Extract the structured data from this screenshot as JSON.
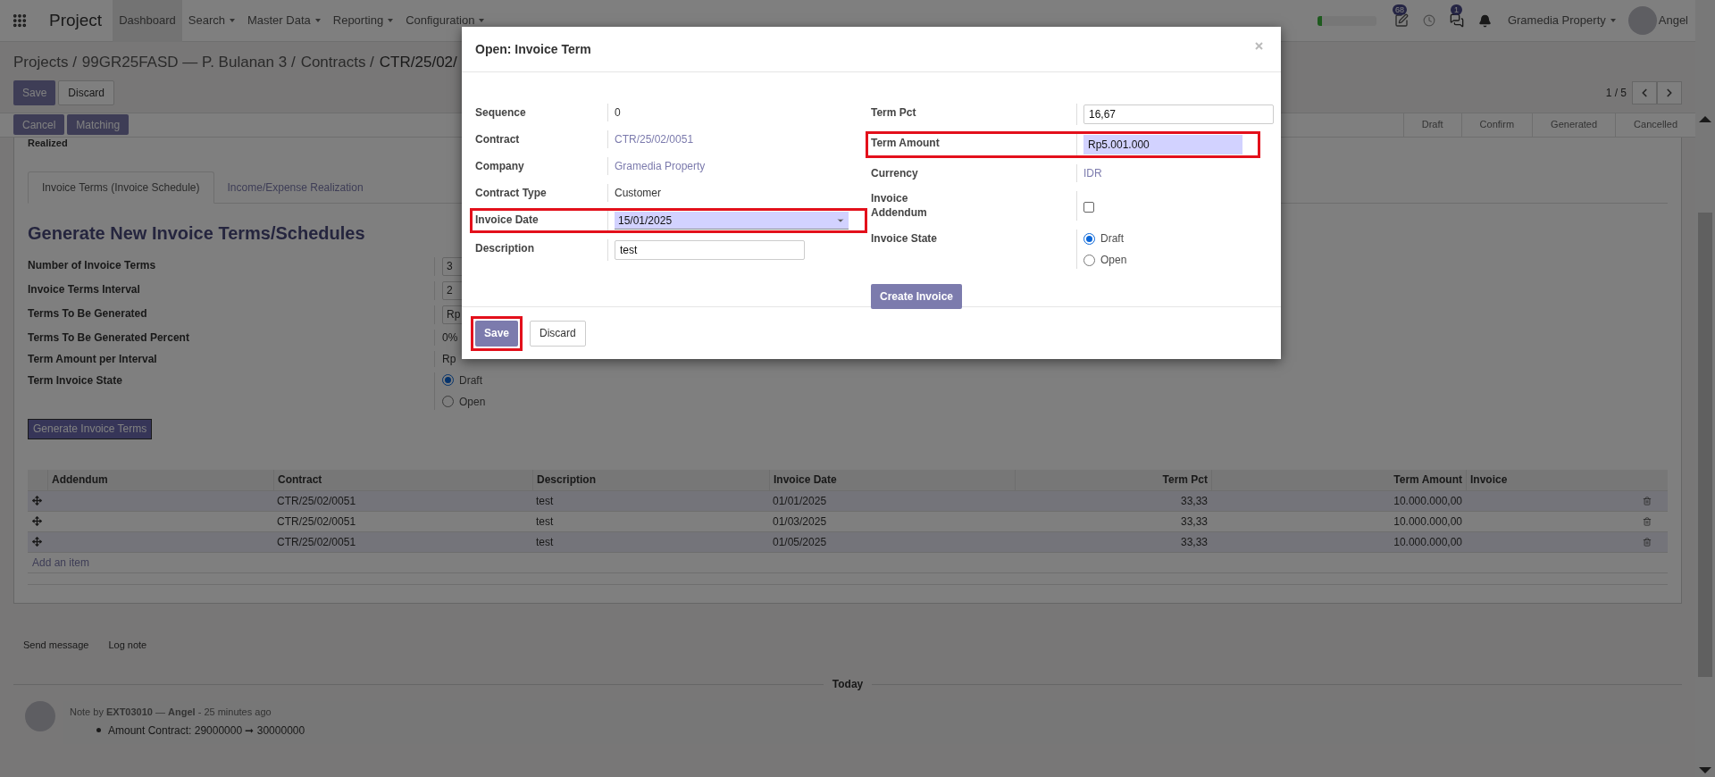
{
  "navbar": {
    "app_title": "Project",
    "menus": [
      {
        "label": "Dashboard",
        "selected": true,
        "dropdown": false
      },
      {
        "label": "Search",
        "selected": false,
        "dropdown": true
      },
      {
        "label": "Master Data",
        "selected": false,
        "dropdown": true
      },
      {
        "label": "Reporting",
        "selected": false,
        "dropdown": true
      },
      {
        "label": "Configuration",
        "selected": false,
        "dropdown": true
      }
    ],
    "activity_badge": "68",
    "message_badge": "1",
    "company": "Gramedia Property",
    "user": "Angel"
  },
  "breadcrumb": [
    "Projects /",
    "99GR25FASD — P. Bulanan 3 /",
    "Contracts /",
    "CTR/25/02/"
  ],
  "form_buttons": [
    "Save",
    "Discard"
  ],
  "pager": "1 / 5",
  "action_buttons": [
    "Cancel",
    "Matching"
  ],
  "status_steps": [
    "Draft",
    "Confirm",
    "Generated",
    "Cancelled"
  ],
  "cut_label": "Realized",
  "tabs": [
    {
      "label": "Invoice Terms (Invoice Schedule)",
      "selected": true
    },
    {
      "label": "Income/Expense Realization",
      "selected": false
    }
  ],
  "section_title": "Generate New Invoice Terms/Schedules",
  "generator_fields": [
    {
      "label": "Number of Invoice Terms",
      "kind": "input",
      "value": "3"
    },
    {
      "label": "Invoice Terms Interval",
      "kind": "input",
      "value": "2"
    },
    {
      "label": "Terms To Be Generated",
      "kind": "input",
      "value": "Rp"
    },
    {
      "label": "Terms To Be Generated Percent",
      "kind": "text",
      "value": "0%"
    },
    {
      "label": "Term Amount per Interval",
      "kind": "text",
      "value": "Rp"
    },
    {
      "label": "Term Invoice State",
      "kind": "radio",
      "options": [
        {
          "label": "Draft",
          "selected": true
        },
        {
          "label": "Open",
          "selected": false
        }
      ]
    }
  ],
  "generate_button": "Generate Invoice Terms",
  "table": {
    "columns": [
      "Addendum",
      "Contract",
      "Description",
      "Invoice Date",
      "Term Pct",
      "Term Amount",
      "Invoice"
    ],
    "rows": [
      {
        "addendum": "",
        "contract": "CTR/25/02/0051",
        "description": "test",
        "invoice_date": "01/01/2025",
        "term_pct": "33,33",
        "term_amount": "10.000.000,00",
        "invoice": ""
      },
      {
        "addendum": "",
        "contract": "CTR/25/02/0051",
        "description": "test",
        "invoice_date": "01/03/2025",
        "term_pct": "33,33",
        "term_amount": "10.000.000,00",
        "invoice": ""
      },
      {
        "addendum": "",
        "contract": "CTR/25/02/0051",
        "description": "test",
        "invoice_date": "01/05/2025",
        "term_pct": "33,33",
        "term_amount": "10.000.000,00",
        "invoice": ""
      }
    ],
    "add_item": "Add an item"
  },
  "chatter": {
    "actions": [
      "Send message",
      "Log note"
    ],
    "date_separator": "Today",
    "note_header": "Note by **EXT03010** — **Angel** - 25 minutes ago",
    "note_change": "Amount Contract: 29000000 ➞ 30000000"
  },
  "modal": {
    "title": "Open: Invoice Term",
    "left_fields": [
      {
        "label": "Sequence",
        "kind": "text",
        "value": "0"
      },
      {
        "label": "Contract",
        "kind": "link",
        "value": "CTR/25/02/0051"
      },
      {
        "label": "Company",
        "kind": "link",
        "value": "Gramedia Property"
      },
      {
        "label": "Contract Type",
        "kind": "text",
        "value": "Customer"
      },
      {
        "label": "Invoice Date",
        "kind": "date",
        "value": "15/01/2025",
        "highlighted": true
      },
      {
        "label": "Description",
        "kind": "input",
        "value": "test"
      }
    ],
    "right_fields": [
      {
        "label": "Term Pct",
        "kind": "input",
        "value": "16,67"
      },
      {
        "label": "Term Amount",
        "kind": "filled",
        "value": "Rp5.001.000",
        "highlighted": true
      },
      {
        "label": "Currency",
        "kind": "link",
        "value": "IDR"
      },
      {
        "label": "Invoice Addendum",
        "kind": "checkbox",
        "checked": false
      },
      {
        "label": "Invoice State",
        "kind": "radio",
        "options": [
          {
            "label": "Draft",
            "selected": true
          },
          {
            "label": "Open",
            "selected": false
          }
        ]
      }
    ],
    "create_button": "Create Invoice",
    "footer_buttons": [
      {
        "label": "Save",
        "primary": true,
        "highlighted": true
      },
      {
        "label": "Discard",
        "primary": false,
        "highlighted": false
      }
    ]
  }
}
